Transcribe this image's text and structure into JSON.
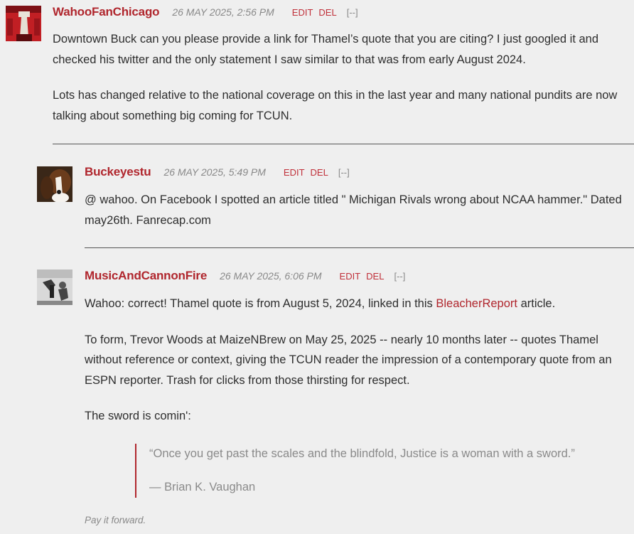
{
  "comments": [
    {
      "author": "WahooFanChicago",
      "date": "26 MAY 2025, 2:56 PM",
      "edit": "EDIT",
      "del": "DEL",
      "collapse": "[--]",
      "p1": "Downtown Buck can you please provide a link for Thamel’s quote that you are citing?  I just googled it and checked his twitter and the only statement I saw similar to that was from early August 2024.",
      "p2": "Lots has changed relative to the national coverage on this in the last year and many national pundits are now talking about something big coming for TCUN."
    },
    {
      "author": "Buckeyestu",
      "date": "26 MAY 2025, 5:49 PM",
      "edit": "EDIT",
      "del": "DEL",
      "collapse": "[--]",
      "p1": "@ wahoo. On Facebook I spotted an article titled \" Michigan Rivals wrong about NCAA hammer.\" Dated may26th. Fanrecap.com"
    },
    {
      "author": "MusicAndCannonFire",
      "date": "26 MAY 2025, 6:06 PM",
      "edit": "EDIT",
      "del": "DEL",
      "collapse": "[--]",
      "p1_before": "Wahoo:  correct!  Thamel quote is from August 5, 2024, linked in this ",
      "p1_link": "BleacherReport",
      "p1_after": " article.",
      "p2": "To form, Trevor Woods at MaizeNBrew on May 25, 2025 -- nearly 10 months later -- quotes Thamel without reference or context, giving the TCUN reader the impression of a contemporary quote from an ESPN reporter. Trash for clicks from those thirsting for respect.",
      "p3": "The sword is comin':",
      "quote": "“Once you get past the scales and the blindfold, Justice is a woman with a sword.”",
      "quote_author": "— Brian K. Vaughan",
      "signature": "Pay it forward."
    }
  ]
}
